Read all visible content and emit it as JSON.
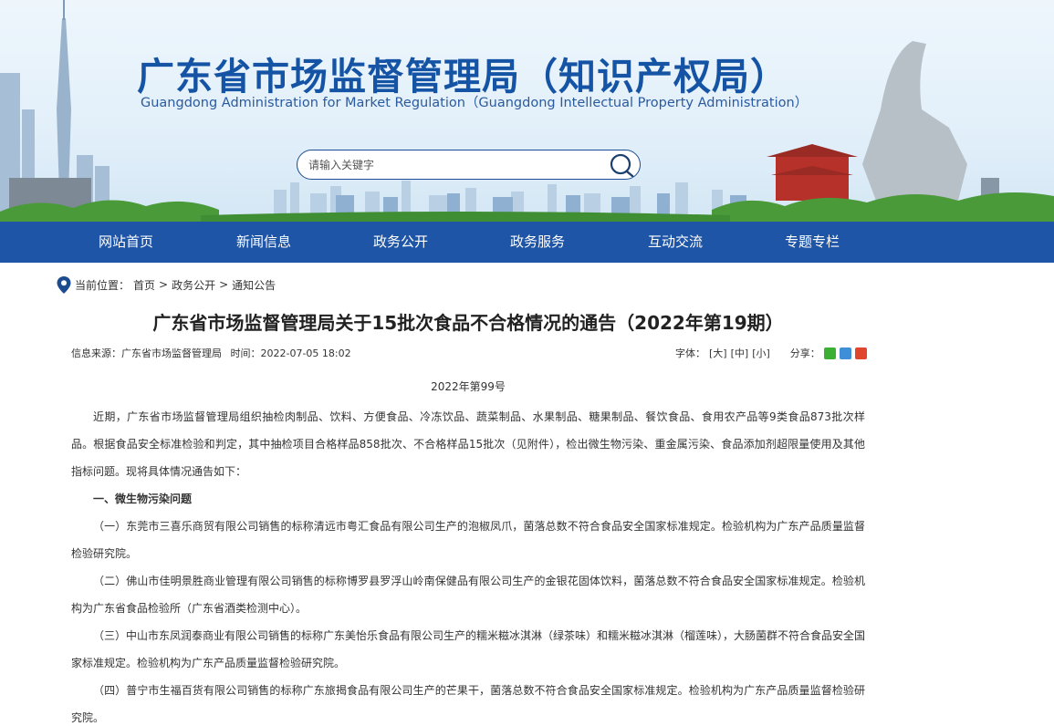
{
  "header": {
    "title_cn": "广东省市场监督管理局（知识产权局）",
    "title_en": "Guangdong Administration for Market Regulation（Guangdong Intellectual Property Administration）",
    "search": {
      "placeholder": "请输入关键字"
    }
  },
  "nav": [
    "网站首页",
    "新闻信息",
    "政务公开",
    "政务服务",
    "互动交流",
    "专题专栏"
  ],
  "breadcrumb": {
    "label": "当前位置：",
    "items": [
      "首页",
      "政务公开",
      "通知公告"
    ],
    "sep": ">"
  },
  "article": {
    "title": "广东省市场监督管理局关于15批次食品不合格情况的通告（2022年第19期）",
    "source": "信息来源：广东省市场监督管理局",
    "time": "时间：2022-07-05 18:02",
    "font_label": "字体：",
    "font_large": "[大]",
    "font_medium": "[中]",
    "font_small": "[小]",
    "share_label": "分享：",
    "issue_no": "2022年第99号",
    "paragraphs": [
      "近期，广东省市场监督管理局组织抽检肉制品、饮料、方便食品、冷冻饮品、蔬菜制品、水果制品、糖果制品、餐饮食品、食用农产品等9类食品873批次样品。根据食品安全标准检验和判定，其中抽检项目合格样品858批次、不合格样品15批次（见附件），检出微生物污染、重金属污染、食品添加剂超限量使用及其他指标问题。现将具体情况通告如下：",
      "一、微生物污染问题",
      "（一）东莞市三喜乐商贸有限公司销售的标称清远市粤汇食品有限公司生产的泡椒凤爪，菌落总数不符合食品安全国家标准规定。检验机构为广东产品质量监督检验研究院。",
      "（二）佛山市佳明景胜商业管理有限公司销售的标称博罗县罗浮山岭南保健品有限公司生产的金银花固体饮料，菌落总数不符合食品安全国家标准规定。检验机构为广东省食品检验所（广东省酒类检测中心）。",
      "（三）中山市东凤润泰商业有限公司销售的标称广东美怡乐食品有限公司生产的糯米糍冰淇淋（绿茶味）和糯米糍冰淇淋（榴莲味），大肠菌群不符合食品安全国家标准规定。检验机构为广东产品质量监督检验研究院。",
      "（四）普宁市生福百货有限公司销售的标称广东旅揭食品有限公司生产的芒果干，菌落总数不符合食品安全国家标准规定。检验机构为广东产品质量监督检验研究院。"
    ]
  },
  "colors": {
    "nav_bg": "#1f55a6",
    "title_blue": "#1554a5"
  }
}
